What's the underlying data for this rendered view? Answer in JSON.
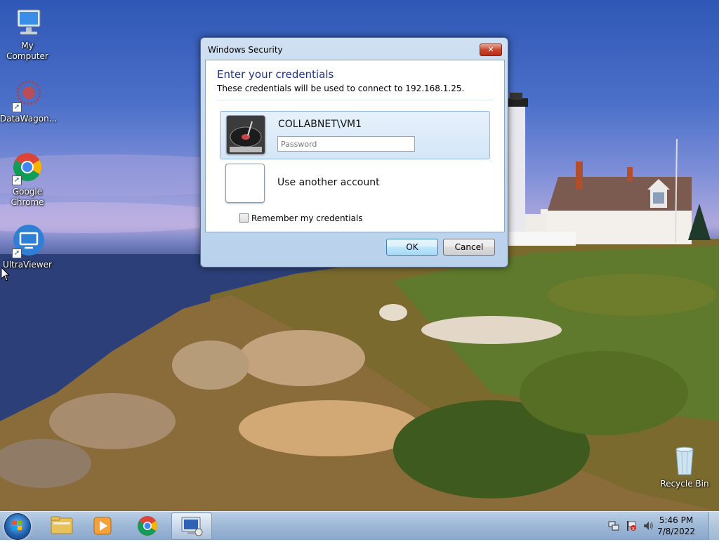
{
  "desktop_icons": [
    {
      "label": "My Computer",
      "icon": "computer-icon"
    },
    {
      "label": "DataWagon...",
      "icon": "datawagon-icon"
    },
    {
      "label": "Google Chrome",
      "icon": "chrome-icon"
    },
    {
      "label": "UltraViewer",
      "icon": "ultraviewer-icon"
    },
    {
      "label": "Recycle Bin",
      "icon": "recycle-bin-icon"
    }
  ],
  "dialog": {
    "title": "Windows Security",
    "heading": "Enter your credentials",
    "subtext": "These credentials will be used to connect to 192.168.1.25.",
    "account_name": "COLLABNET\\VM1",
    "password_placeholder": "Password",
    "password_value": "",
    "other_account_label": "Use another account",
    "remember_label": "Remember my credentials",
    "remember_checked": false,
    "ok_label": "OK",
    "cancel_label": "Cancel",
    "close_glyph": "✕"
  },
  "taskbar": {
    "pinned": [
      "file-explorer-icon",
      "media-player-icon",
      "chrome-icon",
      "remote-desktop-icon"
    ],
    "active_item": "remote-desktop-icon",
    "tray": {
      "time": "5:46 PM",
      "date": "7/8/2022",
      "icons": [
        "network-icon",
        "action-center-flag-icon",
        "volume-icon"
      ]
    }
  },
  "colors": {
    "heading": "#1e3287",
    "taskbar": "#9db7d6"
  }
}
